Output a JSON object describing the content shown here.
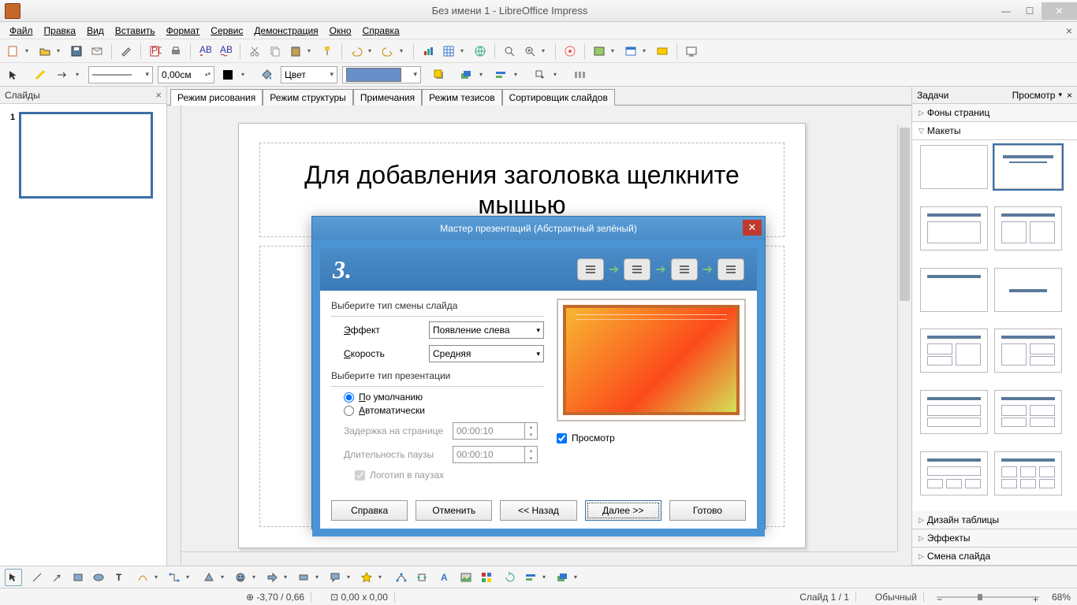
{
  "window": {
    "title": "Без имени 1 - LibreOffice Impress"
  },
  "menu": {
    "file": "Файл",
    "edit": "Правка",
    "view": "Вид",
    "insert": "Вставить",
    "format": "Формат",
    "tools": "Сервис",
    "slideshow": "Демонстрация",
    "window": "Окно",
    "help": "Справка"
  },
  "toolbar2": {
    "width": "0,00см",
    "fillmode": "Цвет"
  },
  "slidepanel": {
    "title": "Слайды",
    "count": "1"
  },
  "viewtabs": {
    "drawing": "Режим рисования",
    "outline": "Режим структуры",
    "notes": "Примечания",
    "handout": "Режим тезисов",
    "sorter": "Сортировщик слайдов"
  },
  "slide": {
    "title_placeholder": "Для добавления заголовка щелкните мышью"
  },
  "taskpanel": {
    "title": "Задачи",
    "viewlabel": "Просмотр",
    "sections": {
      "masterpages": "Фоны страниц",
      "layouts": "Макеты",
      "tabledesign": "Дизайн таблицы",
      "effects": "Эффекты",
      "transition": "Смена слайда"
    }
  },
  "dialog": {
    "title": "Мастер презентаций (Абстрактный зелёный)",
    "step": "3.",
    "group1_label": "Выберите тип смены слайда",
    "effect_label": "Эффект",
    "effect_value": "Появление слева",
    "speed_label": "Скорость",
    "speed_value": "Средняя",
    "group2_label": "Выберите тип презентации",
    "radio_default": "По умолчанию",
    "radio_auto": "Автоматически",
    "delay_label": "Задержка на странице",
    "delay_value": "00:00:10",
    "pause_label": "Длительность паузы",
    "pause_value": "00:00:10",
    "logo_check": "Логотип в паузах",
    "preview_check": "Просмотр",
    "buttons": {
      "help": "Справка",
      "cancel": "Отменить",
      "back": "<< Назад",
      "next": "Далее >>",
      "finish": "Готово"
    }
  },
  "statusbar": {
    "coords": "-3,70 / 0,66",
    "size": "0,00 x 0,00",
    "slide": "Слайд 1 / 1",
    "template": "Обычный",
    "zoom": "68%"
  }
}
